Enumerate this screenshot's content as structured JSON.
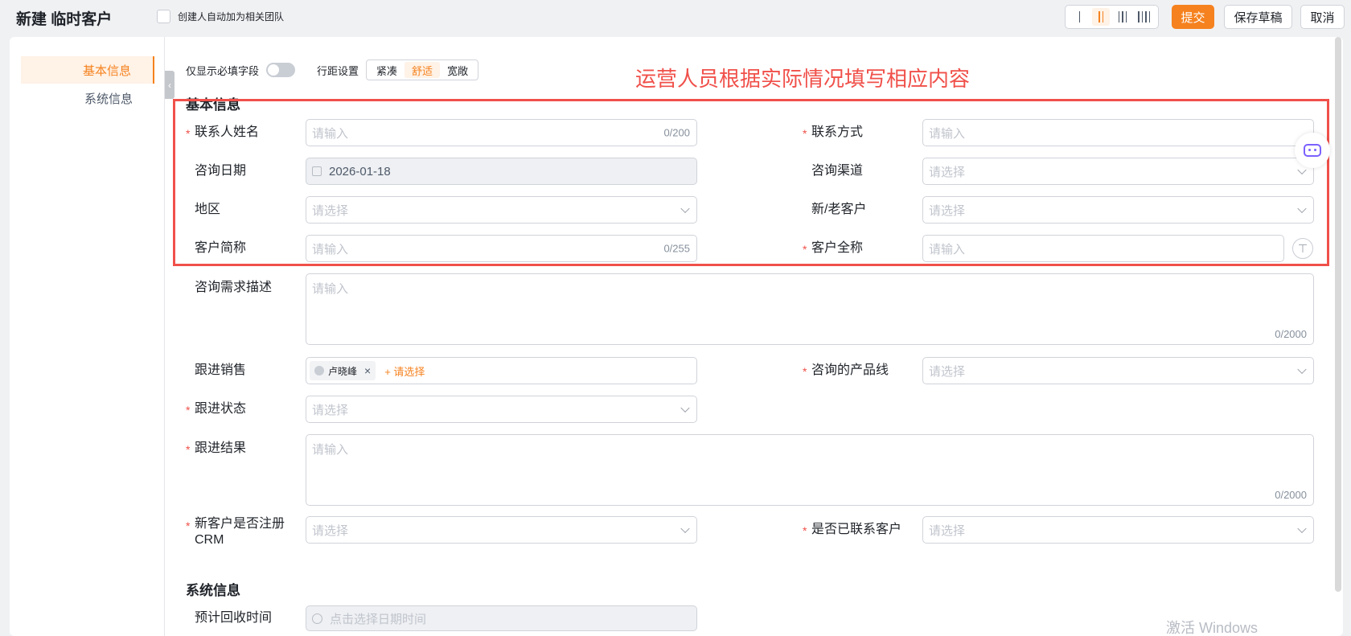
{
  "header": {
    "title": "新建 临时客户",
    "auto_team_label": "创建人自动加为相关团队",
    "submit_label": "提交",
    "draft_label": "保存草稿",
    "cancel_label": "取消"
  },
  "sidebar": {
    "items": [
      {
        "label": "基本信息",
        "active": true
      },
      {
        "label": "系统信息",
        "active": false
      }
    ]
  },
  "toolbar": {
    "required_only_label": "仅显示必填字段",
    "spacing_label": "行距设置",
    "spacing_options": [
      {
        "label": "紧凑",
        "active": false
      },
      {
        "label": "舒适",
        "active": true
      },
      {
        "label": "宽敞",
        "active": false
      }
    ]
  },
  "annotation": "运营人员根据实际情况填写相应内容",
  "basic_section": {
    "title": "基本信息",
    "contact_name": {
      "label": "联系人姓名",
      "placeholder": "请输入",
      "counter": "0/200"
    },
    "contact_method": {
      "label": "联系方式",
      "placeholder": "请输入"
    },
    "consult_date": {
      "label": "咨询日期",
      "value": "2026-01-18"
    },
    "consult_channel": {
      "label": "咨询渠道",
      "placeholder": "请选择"
    },
    "region": {
      "label": "地区",
      "placeholder": "请选择"
    },
    "new_old_customer": {
      "label": "新/老客户",
      "placeholder": "请选择"
    },
    "customer_short_name": {
      "label": "客户简称",
      "placeholder": "请输入",
      "counter": "0/255"
    },
    "customer_full_name": {
      "label": "客户全称",
      "placeholder": "请输入"
    },
    "consult_desc": {
      "label": "咨询需求描述",
      "placeholder": "请输入",
      "counter": "0/2000"
    },
    "sales_follow": {
      "label": "跟进销售",
      "tag": "卢晓峰",
      "add_label": "+ 请选择"
    },
    "product_line": {
      "label": "咨询的产品线",
      "placeholder": "请选择"
    },
    "follow_status": {
      "label": "跟进状态",
      "placeholder": "请选择"
    },
    "follow_result": {
      "label": "跟进结果",
      "placeholder": "请输入",
      "counter": "0/2000"
    },
    "crm_registered": {
      "label_line1": "新客户是否注册",
      "label_line2": "CRM",
      "placeholder": "请选择"
    },
    "contacted": {
      "label": "是否已联系客户",
      "placeholder": "请选择"
    }
  },
  "system_section": {
    "title": "系统信息",
    "recovery_time": {
      "label": "预计回收时间",
      "placeholder": "点击选择日期时间"
    }
  },
  "required_mark": "*",
  "watermark": "激活 Windows"
}
